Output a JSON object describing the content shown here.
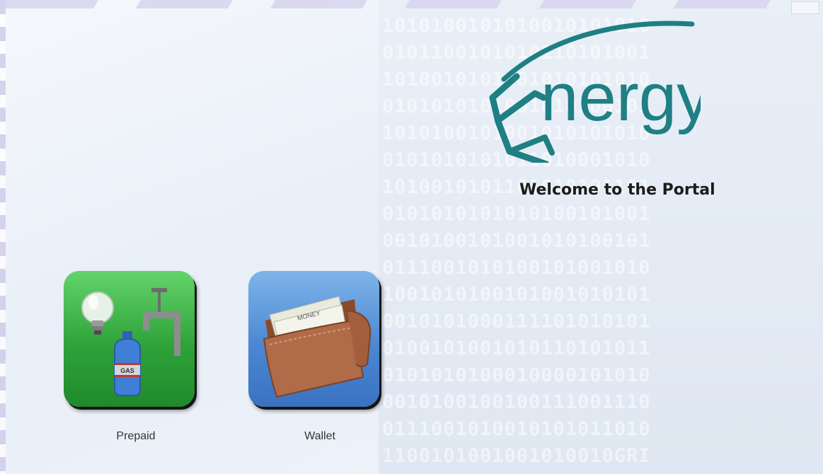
{
  "logo": {
    "text": "nergy",
    "brand_color": "#1e7f84"
  },
  "welcome": {
    "title": "Welcome to the Portal"
  },
  "tiles": [
    {
      "label": "Prepaid",
      "icon": "utilities-icon",
      "color": "#3bb44a",
      "badge_text": "GAS"
    },
    {
      "label": "Wallet",
      "icon": "wallet-icon",
      "color": "#4a86d0",
      "note_text": "MONEY"
    }
  ],
  "background": {
    "rows": [
      "1010100101010010101010",
      "0101100101010110101001",
      "1010010101001010101010",
      "0101010101001010100101",
      "1010100101001010101010",
      "0101010101011010001010",
      "1010010101101010101101",
      "0101010101010100101001",
      "0010100101001010100101",
      "0111001010100101001010",
      "1001010100101001010101",
      "0010101000111101010101",
      "0100101001010110101011",
      "0101010100010000101010",
      "0010100100100111001110",
      "0111001010010101011010",
      "1100101001001010010GRI"
    ]
  }
}
